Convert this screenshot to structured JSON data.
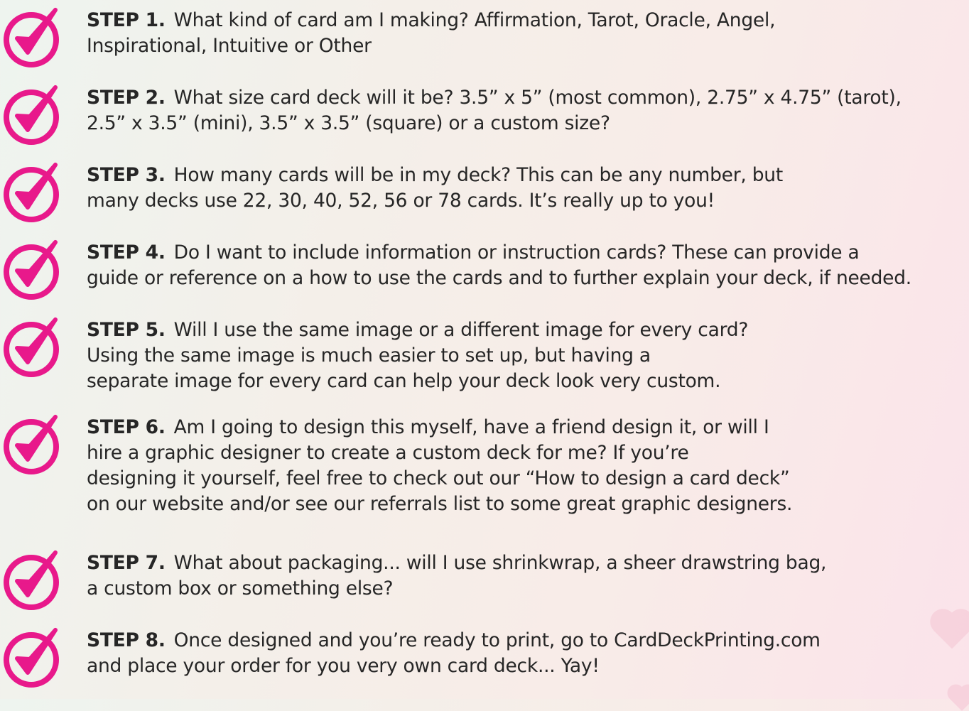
{
  "colors": {
    "check": "#e8198b",
    "text": "#262626",
    "heart": "#f7cfdb"
  },
  "icon": "checkmark-circle-icon",
  "steps": [
    {
      "label": "STEP 1.",
      "lines": [
        "What kind of card am I making? Affirmation, Tarot, Oracle, Angel,",
        "Inspirational, Intuitive or Other"
      ]
    },
    {
      "label": "STEP 2.",
      "lines": [
        "What size card deck will it be?  3.5” x 5” (most common), 2.75” x 4.75” (tarot),",
        "2.5” x 3.5” (mini), 3.5” x 3.5” (square) or a custom size?"
      ]
    },
    {
      "label": "STEP 3.",
      "lines": [
        "How many cards will be in my deck? This can be any number, but",
        "many decks use 22, 30, 40, 52, 56 or 78 cards. It’s really up to you!"
      ]
    },
    {
      "label": "STEP 4.",
      "lines": [
        "Do I want to include information or instruction cards? These can provide a",
        "guide or reference on a how to use the cards and to further explain your deck, if needed."
      ]
    },
    {
      "label": "STEP 5.",
      "lines": [
        "Will I use the same image or a different image for every card?",
        "Using the same image is much easier to set up, but having a",
        "separate image for every card can help your deck look very custom."
      ]
    },
    {
      "label": "STEP 6.",
      "lines": [
        "Am I going to design this myself, have a friend design it, or will I",
        "hire a graphic designer to create a custom deck for me? If you’re",
        "designing it yourself, feel free to check out our “How to design a card deck”",
        "on our website and/or see our referrals list to some great graphic designers."
      ]
    },
    {
      "label": "STEP 7.",
      "lines": [
        "What about packaging... will I use shrinkwrap, a sheer drawstring bag,",
        "a custom box or something else?"
      ]
    },
    {
      "label": "STEP 8.",
      "lines": [
        "Once designed and you’re ready to print, go to CardDeckPrinting.com",
        "and place your order for you very own card deck... Yay!"
      ]
    }
  ]
}
